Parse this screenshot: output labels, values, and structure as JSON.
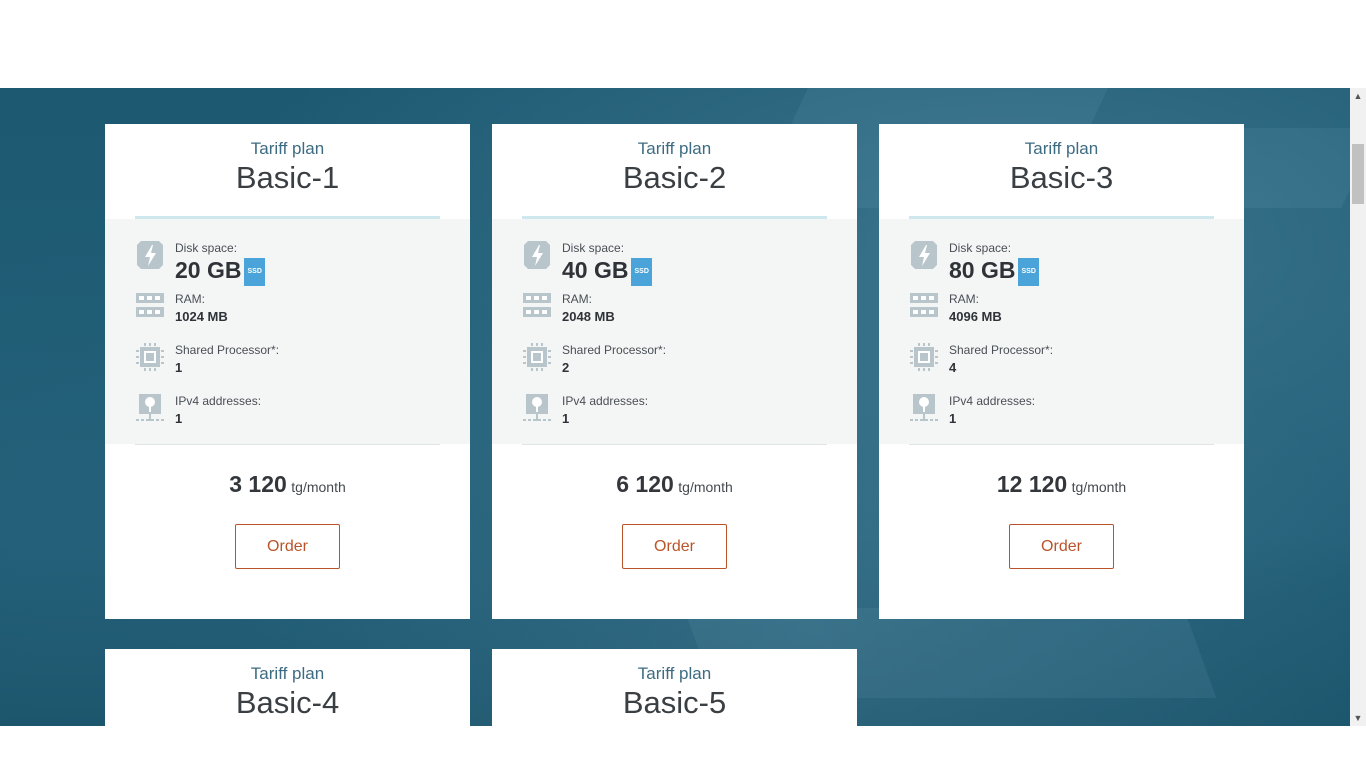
{
  "plans": [
    {
      "subtitle": "Tariff plan",
      "name": "Basic-1",
      "disk_label": "Disk space:",
      "disk_value": "20 GB",
      "disk_badge": "SSD",
      "ram_label": "RAM:",
      "ram_value": "1024 MB",
      "cpu_label": "Shared Processor*:",
      "cpu_value": "1",
      "ip_label": "IPv4 addresses:",
      "ip_value": "1",
      "price": "3 120",
      "price_unit": "tg/month",
      "order_label": "Order"
    },
    {
      "subtitle": "Tariff plan",
      "name": "Basic-2",
      "disk_label": "Disk space:",
      "disk_value": "40 GB",
      "disk_badge": "SSD",
      "ram_label": "RAM:",
      "ram_value": "2048 MB",
      "cpu_label": "Shared Processor*:",
      "cpu_value": "2",
      "ip_label": "IPv4 addresses:",
      "ip_value": "1",
      "price": "6 120",
      "price_unit": "tg/month",
      "order_label": "Order"
    },
    {
      "subtitle": "Tariff plan",
      "name": "Basic-3",
      "disk_label": "Disk space:",
      "disk_value": "80 GB",
      "disk_badge": "SSD",
      "ram_label": "RAM:",
      "ram_value": "4096 MB",
      "cpu_label": "Shared Processor*:",
      "cpu_value": "4",
      "ip_label": "IPv4 addresses:",
      "ip_value": "1",
      "price": "12 120",
      "price_unit": "tg/month",
      "order_label": "Order"
    },
    {
      "subtitle": "Tariff plan",
      "name": "Basic-4"
    },
    {
      "subtitle": "Tariff plan",
      "name": "Basic-5"
    }
  ],
  "icons": {
    "disk": "lightning-disk-icon",
    "ram": "ram-module-icon",
    "cpu": "processor-chip-icon",
    "ip": "network-location-icon"
  },
  "colors": {
    "background": "#1f5d75",
    "accent_button": "#b9542a",
    "title_line": "#cfe8ee",
    "ssd_badge": "#4aa3d9",
    "spec_panel": "#f4f6f6"
  }
}
